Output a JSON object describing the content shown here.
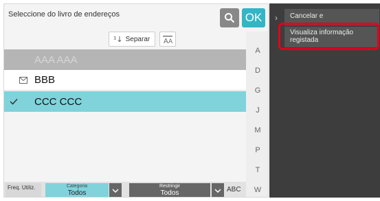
{
  "header": {
    "title": "Seleccione do livro de endereços",
    "ok_label": "OK"
  },
  "toolbar": {
    "sort_label": "Separar",
    "sort_icon": "sort-numeric-icon",
    "font_toggle_icon": "font-size-icon"
  },
  "list": {
    "rows": [
      {
        "label": "AAA AAA",
        "state": "disabled",
        "icon": ""
      },
      {
        "label": "BBB",
        "state": "normal",
        "icon": "mail-icon"
      },
      {
        "label": "CCC CCC",
        "state": "selected",
        "icon": "check-icon"
      }
    ]
  },
  "index": [
    "A",
    "D",
    "G",
    "J",
    "M",
    "P",
    "T",
    "W"
  ],
  "bottom": {
    "freq_label": "Freq. Utiliz.",
    "category_caption": "Categoria",
    "category_value": "Todos",
    "restrict_caption": "Restringir",
    "restrict_value": "Todos",
    "abc_label": "ABC"
  },
  "menu": {
    "cancel_label": "Cancelar e",
    "view_label": "Visualiza informação registada"
  },
  "colors": {
    "accent": "#33b5c5",
    "selected_row": "#80d3db",
    "highlight": "#e2001a",
    "menu_bg": "#3d3d3d"
  }
}
